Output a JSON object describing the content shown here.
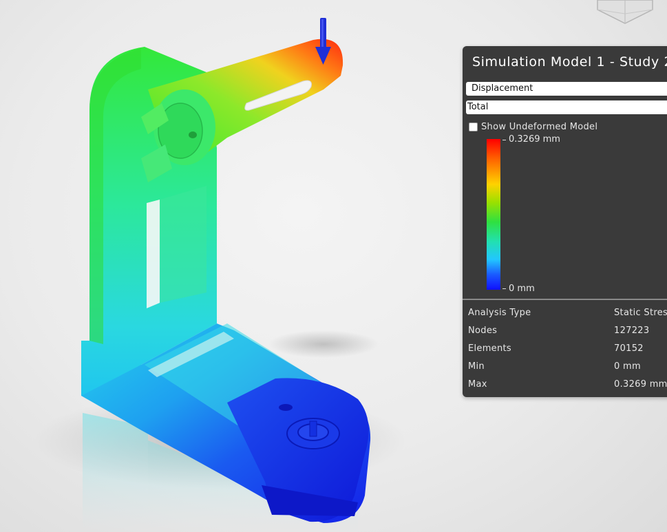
{
  "panel": {
    "title": "Simulation Model 1 - Study 2 -",
    "result_type": "Displacement",
    "component": "Total",
    "show_undeformed_label": "Show Undeformed Model",
    "show_undeformed_checked": false
  },
  "legend": {
    "max_label": "0.3269 mm",
    "min_label": "0 mm"
  },
  "stats": [
    {
      "label": "Analysis Type",
      "value": "Static Stres"
    },
    {
      "label": "Nodes",
      "value": "127223"
    },
    {
      "label": "Elements",
      "value": "70152"
    },
    {
      "label": "Min",
      "value": "0 mm"
    },
    {
      "label": "Max",
      "value": "0.3269 mm"
    }
  ],
  "colors": {
    "panel_bg": "#3a3a3a",
    "legend_max_color": "#ff0000",
    "legend_min_color": "#1010ff",
    "load_arrow": "#1f2fd6"
  },
  "viewport": {
    "model": "bracket-displacement-result",
    "load_icon": "force-arrow-icon"
  }
}
